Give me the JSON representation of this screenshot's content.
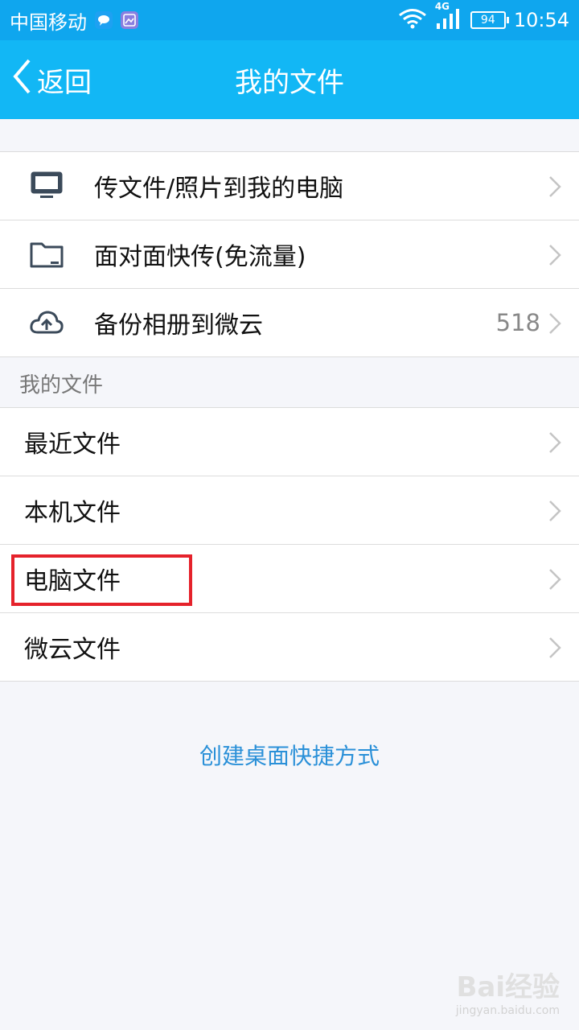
{
  "status_bar": {
    "carrier": "中国移动",
    "network": "4G",
    "battery": "94",
    "time": "10:54",
    "icons": [
      "chat-bubble-icon",
      "image-icon",
      "wifi-icon",
      "signal-icon",
      "battery-icon"
    ]
  },
  "header": {
    "back_label": "返回",
    "title": "我的文件"
  },
  "quick_actions": [
    {
      "label": "传文件/照片到我的电脑",
      "icon": "monitor-icon"
    },
    {
      "label": "面对面快传(免流量)",
      "icon": "folder-icon"
    },
    {
      "label": "备份相册到微云",
      "icon": "cloud-upload-icon",
      "count": "518"
    }
  ],
  "section": {
    "header": "我的文件",
    "items": [
      {
        "label": "最近文件"
      },
      {
        "label": "本机文件"
      },
      {
        "label": "电脑文件"
      },
      {
        "label": "微云文件"
      }
    ]
  },
  "footer": {
    "shortcut_link": "创建桌面快捷方式"
  },
  "watermark": {
    "main": "Bai经验",
    "sub": "jingyan.baidu.com"
  },
  "colors": {
    "title_bar": "#12b7f5",
    "status_bar": "#0fa6ee",
    "link": "#2a90d8",
    "highlight": "#e5222b"
  }
}
